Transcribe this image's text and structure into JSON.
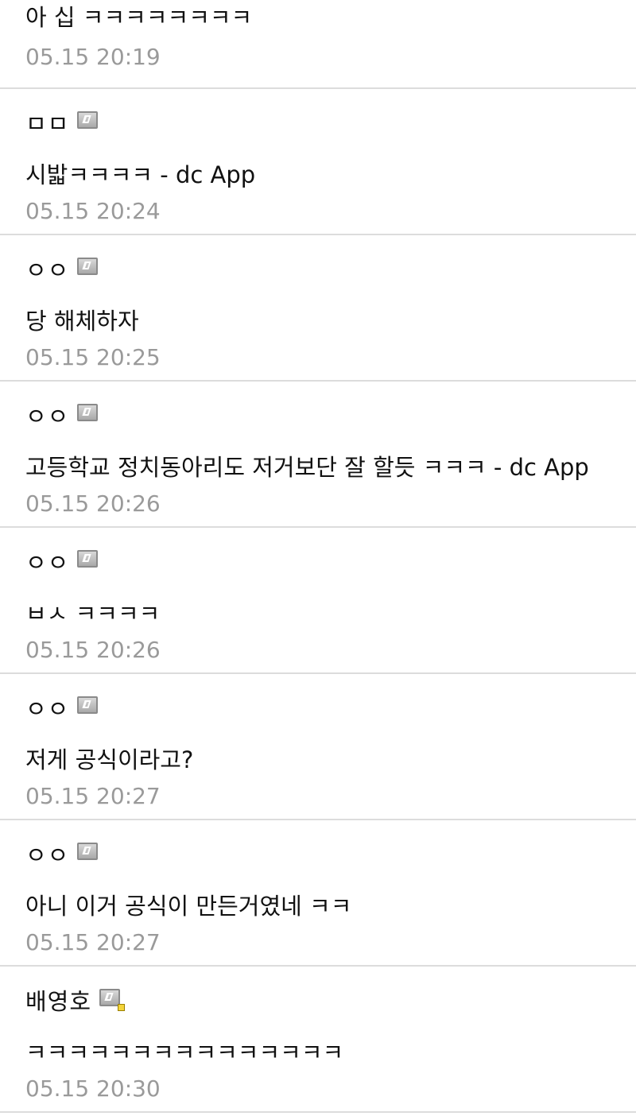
{
  "comments": [
    {
      "author": "",
      "content": "아 십 ㅋㅋㅋㅋㅋㅋㅋㅋ",
      "time": "05.15 20:19",
      "icon": "gallery-user-icon"
    },
    {
      "author": "ㅁㅁ",
      "content": "시밟ㅋㅋㅋㅋ - dc App",
      "time": "05.15 20:24",
      "icon": "gallery-user-icon"
    },
    {
      "author": "ㅇㅇ",
      "content": "당 해체하자",
      "time": "05.15 20:25",
      "icon": "gallery-user-icon"
    },
    {
      "author": "ㅇㅇ",
      "content": "고등학교 정치동아리도 저거보단 잘 할듯 ㅋㅋㅋ - dc App",
      "time": "05.15 20:26",
      "icon": "gallery-user-icon"
    },
    {
      "author": "ㅇㅇ",
      "content": "ㅂㅅ ㅋㅋㅋㅋ",
      "time": "05.15 20:26",
      "icon": "gallery-user-icon"
    },
    {
      "author": "ㅇㅇ",
      "content": "저게 공식이라고?",
      "time": "05.15 20:27",
      "icon": "gallery-user-icon"
    },
    {
      "author": "ㅇㅇ",
      "content": "아니 이거 공식이 만든거였네 ㅋㅋ",
      "time": "05.15 20:27",
      "icon": "gallery-user-icon"
    },
    {
      "author": "배영호",
      "content": "ㅋㅋㅋㅋㅋㅋㅋㅋㅋㅋㅋㅋㅋㅋㅋ",
      "time": "05.15 20:30",
      "icon": "fixed-user-icon"
    }
  ]
}
